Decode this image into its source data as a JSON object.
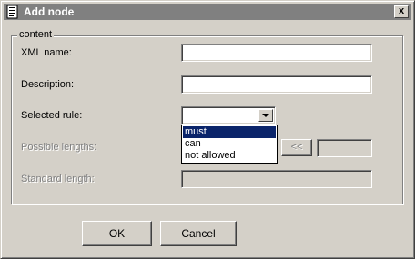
{
  "window": {
    "title": "Add node",
    "close_label": "x"
  },
  "group": {
    "label": "content"
  },
  "fields": {
    "xml_name": {
      "label": "XML name:",
      "value": ""
    },
    "description": {
      "label": "Description:",
      "value": ""
    },
    "selected_rule": {
      "label": "Selected rule:",
      "value": ""
    },
    "possible_lengths": {
      "label": "Possible lengths:",
      "move_label": "<<",
      "value": ""
    },
    "standard_length": {
      "label": "Standard length:",
      "value": ""
    }
  },
  "rule_options": [
    "must",
    "can",
    "not allowed"
  ],
  "selected_option_index": 0,
  "buttons": {
    "ok": "OK",
    "cancel": "Cancel"
  },
  "colors": {
    "dialog_bg": "#d4d0c8",
    "title_bar": "#808080",
    "selection": "#0a246a"
  }
}
